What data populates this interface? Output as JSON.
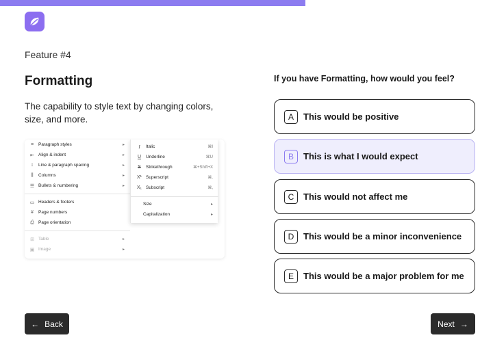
{
  "progress": {
    "fraction": 0.62,
    "color": "#8c7cf0"
  },
  "logo": {
    "icon": "leaf-logo-icon",
    "color": "#8c6ef0"
  },
  "feature": {
    "number": "Feature #4",
    "title": "Formatting",
    "description": "The capability to style text by changing colors, size, and more."
  },
  "menu_illustration": {
    "left_items": [
      {
        "icon": "≡",
        "label": "Paragraph styles",
        "arrow": "▸"
      },
      {
        "icon": "⇤",
        "label": "Align & indent",
        "arrow": "▸"
      },
      {
        "icon": "↕",
        "label": "Line & paragraph spacing",
        "arrow": "▸"
      },
      {
        "icon": "⫼",
        "label": "Columns",
        "arrow": "▸"
      },
      {
        "icon": "☰",
        "label": "Bullets & numbering",
        "arrow": "▸"
      },
      {
        "icon": "▭",
        "label": "Headers & footers",
        "arrow": ""
      },
      {
        "icon": "#",
        "label": "Page numbers",
        "arrow": ""
      },
      {
        "icon": "⎙",
        "label": "Page orientation",
        "arrow": ""
      },
      {
        "icon": "⊞",
        "label": "Table",
        "arrow": "▸"
      },
      {
        "icon": "▣",
        "label": "Image",
        "arrow": "▸"
      }
    ],
    "right_items": [
      {
        "icon": "I",
        "label": "Italic",
        "shortcut": "⌘I"
      },
      {
        "icon": "U",
        "label": "Underline",
        "shortcut": "⌘U"
      },
      {
        "icon": "S",
        "label": "Strikethrough",
        "shortcut": "⌘+Shift+X"
      },
      {
        "icon": "X¹",
        "label": "Superscript",
        "shortcut": "⌘."
      },
      {
        "icon": "X₁",
        "label": "Subscript",
        "shortcut": "⌘,"
      },
      {
        "icon": "",
        "label": "Size",
        "shortcut": "▸"
      },
      {
        "icon": "",
        "label": "Capitalization",
        "shortcut": "▸"
      }
    ]
  },
  "question": "If you have Formatting, how would you feel?",
  "options": [
    {
      "letter": "A",
      "label": "This would be positive",
      "selected": false
    },
    {
      "letter": "B",
      "label": "This is what I would expect",
      "selected": true
    },
    {
      "letter": "C",
      "label": "This would not affect me",
      "selected": false
    },
    {
      "letter": "D",
      "label": "This would be a minor inconvenience",
      "selected": false
    },
    {
      "letter": "E",
      "label": "This would be a major problem for me",
      "selected": false
    }
  ],
  "nav": {
    "back_label": "Back",
    "back_icon": "arrow-left-icon",
    "next_label": "Next",
    "next_icon": "arrow-right-icon"
  }
}
